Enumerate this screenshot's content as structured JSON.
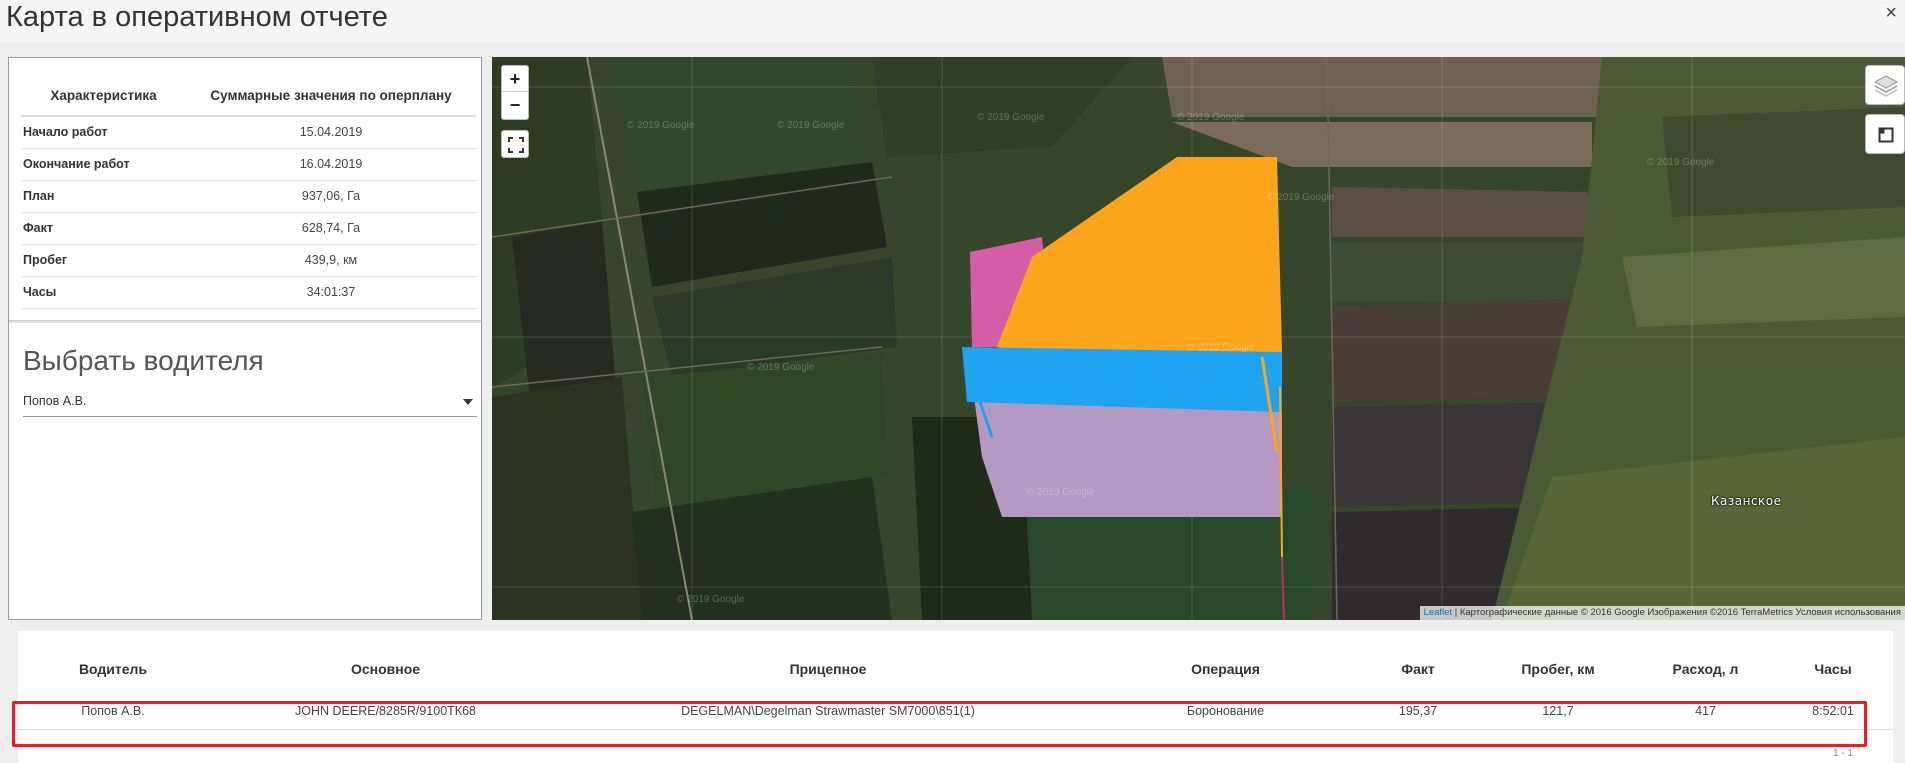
{
  "window": {
    "title": "Карта в оперативном отчете",
    "close_label": "×"
  },
  "summary": {
    "headers": [
      "Характеристика",
      "Суммарные значения по оперплану"
    ],
    "rows": [
      {
        "label": "Начало работ",
        "value": "15.04.2019"
      },
      {
        "label": "Окончание работ",
        "value": "16.04.2019"
      },
      {
        "label": "План",
        "value": "937,06, Га"
      },
      {
        "label": "Факт",
        "value": "628,74, Га"
      },
      {
        "label": "Пробег",
        "value": "439,9, км"
      },
      {
        "label": "Часы",
        "value": "34:01:37"
      }
    ]
  },
  "driver_picker": {
    "heading": "Выбрать водителя",
    "selected": "Попов А.В."
  },
  "map": {
    "zoom_in": "+",
    "zoom_out": "−",
    "attribution_link": "Leaflet",
    "attribution_text": " | Картографические данные © 2016 Google Изображения ©2016 TerraMetrics Условия использования",
    "place_label": "Казанское",
    "watermark": "© 2019 Google",
    "colors": {
      "orange": "#ffa51c",
      "blue": "#1ea4f0",
      "pink": "#d75ca6",
      "lavender": "#b49ac2"
    }
  },
  "operations": {
    "headers": [
      "Водитель",
      "Основное",
      "Прицепное",
      "Операция",
      "Факт",
      "Пробег, км",
      "Расход, л",
      "Часы"
    ],
    "rows": [
      {
        "driver": "Попов А.В.",
        "main": "JOHN DEERE/8285R/9100ТК68",
        "trailer": "DEGELMAN\\Degelman Strawmaster SM7000\\851(1)",
        "operation": "Боронование",
        "fact": "195,37",
        "mileage": "121,7",
        "consumption": "417",
        "hours": "8:52:01"
      }
    ],
    "paging": "1 - 1"
  }
}
